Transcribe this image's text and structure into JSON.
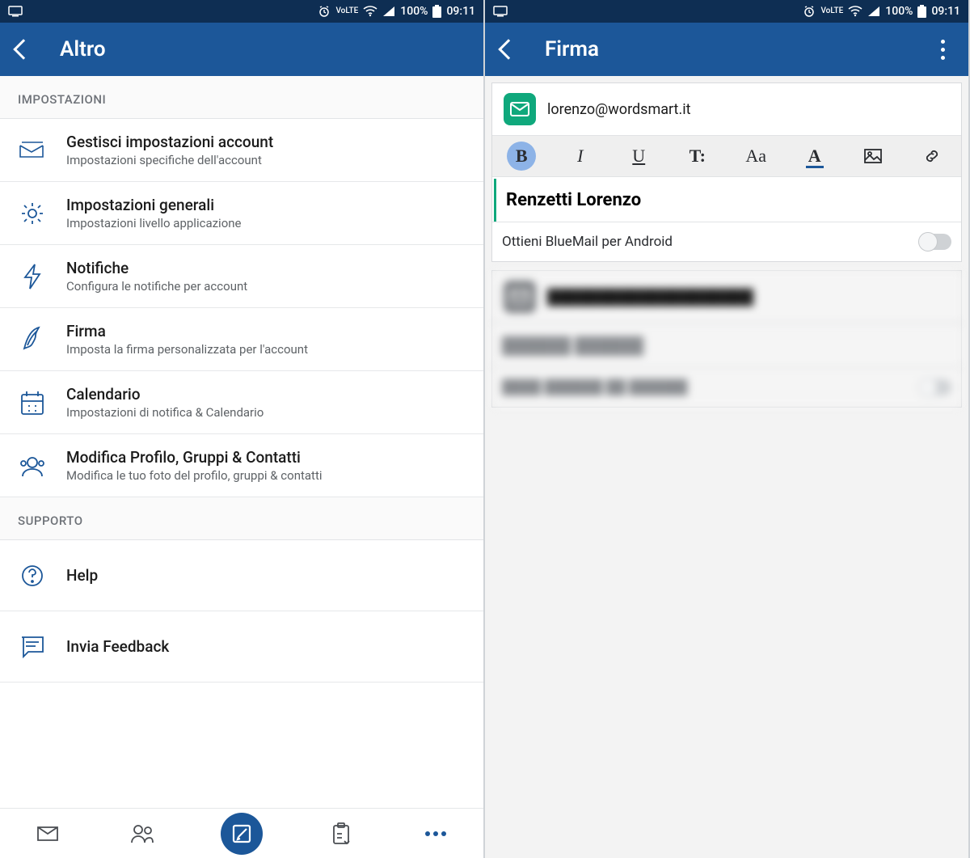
{
  "statusbar": {
    "lte_label": "VoLTE",
    "battery": "100%",
    "time": "09:11"
  },
  "left": {
    "title": "Altro",
    "sections": [
      {
        "header": "IMPOSTAZIONI",
        "items": [
          {
            "title": "Gestisci impostazioni account",
            "sub": "Impostazioni specifiche dell'account"
          },
          {
            "title": "Impostazioni generali",
            "sub": "Impostazioni livello applicazione"
          },
          {
            "title": "Notifiche",
            "sub": "Configura le notifiche per account"
          },
          {
            "title": "Firma",
            "sub": "Imposta la firma personalizzata per l'account"
          },
          {
            "title": "Calendario",
            "sub": "Impostazioni di notifica & Calendario"
          },
          {
            "title": "Modifica Profilo, Gruppi & Contatti",
            "sub": "Modifica le tuo foto del profilo, gruppi & contatti"
          }
        ]
      },
      {
        "header": "SUPPORTO",
        "items": [
          {
            "title": "Help"
          },
          {
            "title": "Invia Feedback"
          }
        ]
      }
    ]
  },
  "right": {
    "title": "Firma",
    "email": "lorenzo@wordsmart.it",
    "toolbar": {
      "bold": "B",
      "italic": "I",
      "underline": "U",
      "textsize": "T:",
      "case": "Aa",
      "color": "A"
    },
    "signature_text": "Renzetti Lorenzo",
    "promo_label": "Ottieni BlueMail per Android"
  }
}
